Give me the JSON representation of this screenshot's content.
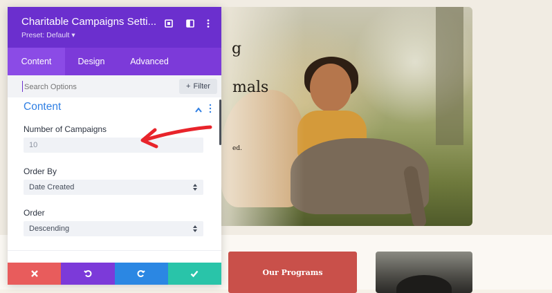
{
  "panel": {
    "title": "Charitable Campaigns Setti...",
    "preset": "Preset: Default ▾",
    "header_icons": [
      "resize-icon",
      "columns-icon",
      "kebab-icon"
    ],
    "tabs": [
      {
        "label": "Content",
        "active": true
      },
      {
        "label": "Design",
        "active": false
      },
      {
        "label": "Advanced",
        "active": false
      }
    ],
    "search": {
      "placeholder": "Search Options"
    },
    "filter_label": "Filter",
    "section": {
      "title": "Content"
    },
    "fields": {
      "campaigns_label": "Number of Campaigns",
      "campaigns_value": "10",
      "order_by_label": "Order By",
      "order_by_value": "Date Created",
      "order_label": "Order",
      "order_value": "Descending"
    },
    "footer": {
      "colors": [
        "#e85c5c",
        "#7c3ad9",
        "#2b87e3",
        "#29c4a9"
      ],
      "icons": [
        "close-icon",
        "undo-icon",
        "redo-icon",
        "check-icon"
      ]
    },
    "accent": "#6b2fce"
  },
  "background": {
    "hero_text_1": "g",
    "hero_text_2": "mals",
    "hero_text_3": "ed.",
    "programs_button": "Our Programs"
  }
}
